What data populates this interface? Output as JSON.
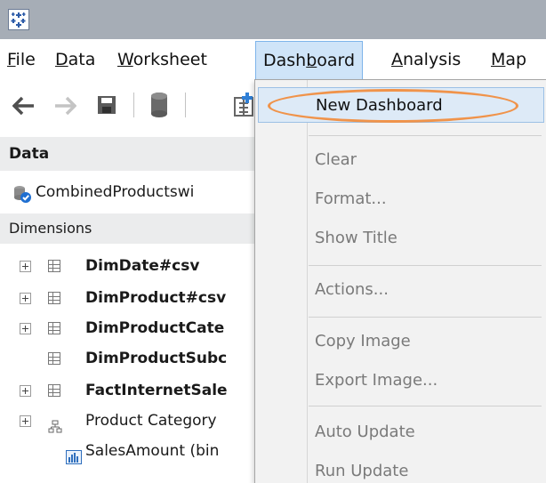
{
  "menubar": {
    "items": [
      {
        "label": "File",
        "underline": "F",
        "rest": "ile"
      },
      {
        "label": "Data",
        "underline": "D",
        "rest": "ata"
      },
      {
        "label": "Worksheet",
        "underline": "W",
        "rest": "orksheet"
      },
      {
        "label": "Dashboard",
        "pre": "Dash",
        "underline": "b",
        "rest": "oard",
        "active": true
      },
      {
        "label": "Analysis",
        "underline": "A",
        "rest": "nalysis"
      },
      {
        "label": "Map",
        "underline": "M",
        "rest": "ap"
      }
    ]
  },
  "toolbar": {
    "icons": [
      "back-arrow-icon",
      "forward-arrow-icon",
      "save-icon",
      "database-icon",
      "new-worksheet-icon"
    ]
  },
  "data_pane": {
    "header": "Data",
    "datasource": "CombinedProductswi",
    "dimensions_label": "Dimensions",
    "tree": [
      {
        "label": "DimDate#csv",
        "bold": true,
        "expandable": true,
        "icon": "table-icon"
      },
      {
        "label": "DimProduct#csv",
        "bold": true,
        "expandable": true,
        "icon": "table-icon"
      },
      {
        "label": "DimProductCate",
        "bold": true,
        "expandable": true,
        "icon": "table-icon"
      },
      {
        "label": "DimProductSubc",
        "bold": true,
        "expandable": false,
        "icon": "table-icon"
      },
      {
        "label": "FactInternetSale",
        "bold": true,
        "expandable": true,
        "icon": "table-icon"
      },
      {
        "label": "Product Category",
        "bold": false,
        "expandable": true,
        "icon": "hierarchy-icon"
      },
      {
        "label": "SalesAmount (bin",
        "bold": false,
        "expandable": false,
        "icon": "bin-chart-icon"
      }
    ]
  },
  "dashboard_menu": {
    "items": [
      {
        "label": "New Dashboard",
        "enabled": true,
        "highlight": true
      },
      {
        "label": "Clear",
        "enabled": false
      },
      {
        "label": "Format...",
        "enabled": false
      },
      {
        "label": "Show Title",
        "enabled": false
      },
      {
        "label": "Actions...",
        "enabled": false
      },
      {
        "label": "Copy Image",
        "enabled": false
      },
      {
        "label": "Export Image...",
        "enabled": false
      },
      {
        "label": "Auto Update",
        "enabled": false
      },
      {
        "label": "Run Update",
        "enabled": false
      }
    ],
    "annotation_color": "#f0934a"
  },
  "colors": {
    "titlebar": "#a6adb6",
    "menu_active_bg": "#cfe4f8",
    "highlight_bg": "#ddeaf7",
    "menu_bg": "#f2f2f2"
  }
}
